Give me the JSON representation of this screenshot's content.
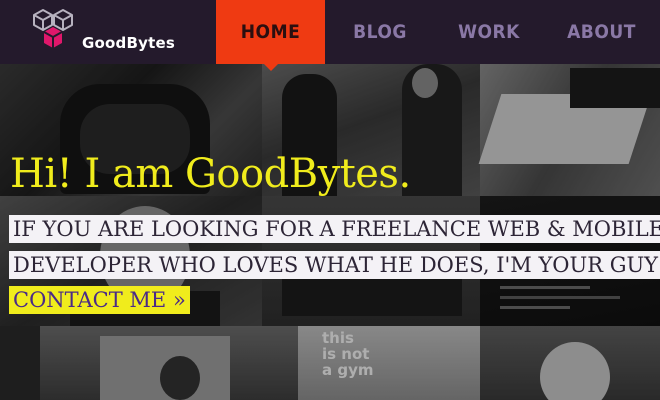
{
  "header": {
    "brand": "GoodBytes",
    "nav": [
      {
        "label": "HOME",
        "active": true
      },
      {
        "label": "BLOG",
        "active": false
      },
      {
        "label": "WORK",
        "active": false
      },
      {
        "label": "ABOUT",
        "active": false
      }
    ]
  },
  "hero": {
    "title": "Hi! I am GoodBytes.",
    "line1": "IF YOU ARE LOOKING FOR A FREELANCE WEB & MOBILE",
    "line2": "DEVELOPER WHO LOVES WHAT HE DOES, I'M YOUR GUY",
    "cta": "CONTACT ME »"
  },
  "collage": {
    "wall_text": [
      "this",
      "is not",
      "a gym"
    ]
  },
  "colors": {
    "header_bg": "#241a2c",
    "nav_active": "#ef3a12",
    "nav_text": "#8a78a6",
    "title_yellow": "#f0ec1c",
    "cta_text": "#4a2a88",
    "logo_magenta": "#e0176b"
  },
  "icons": {
    "logo": "three-cubes-logo-icon"
  }
}
